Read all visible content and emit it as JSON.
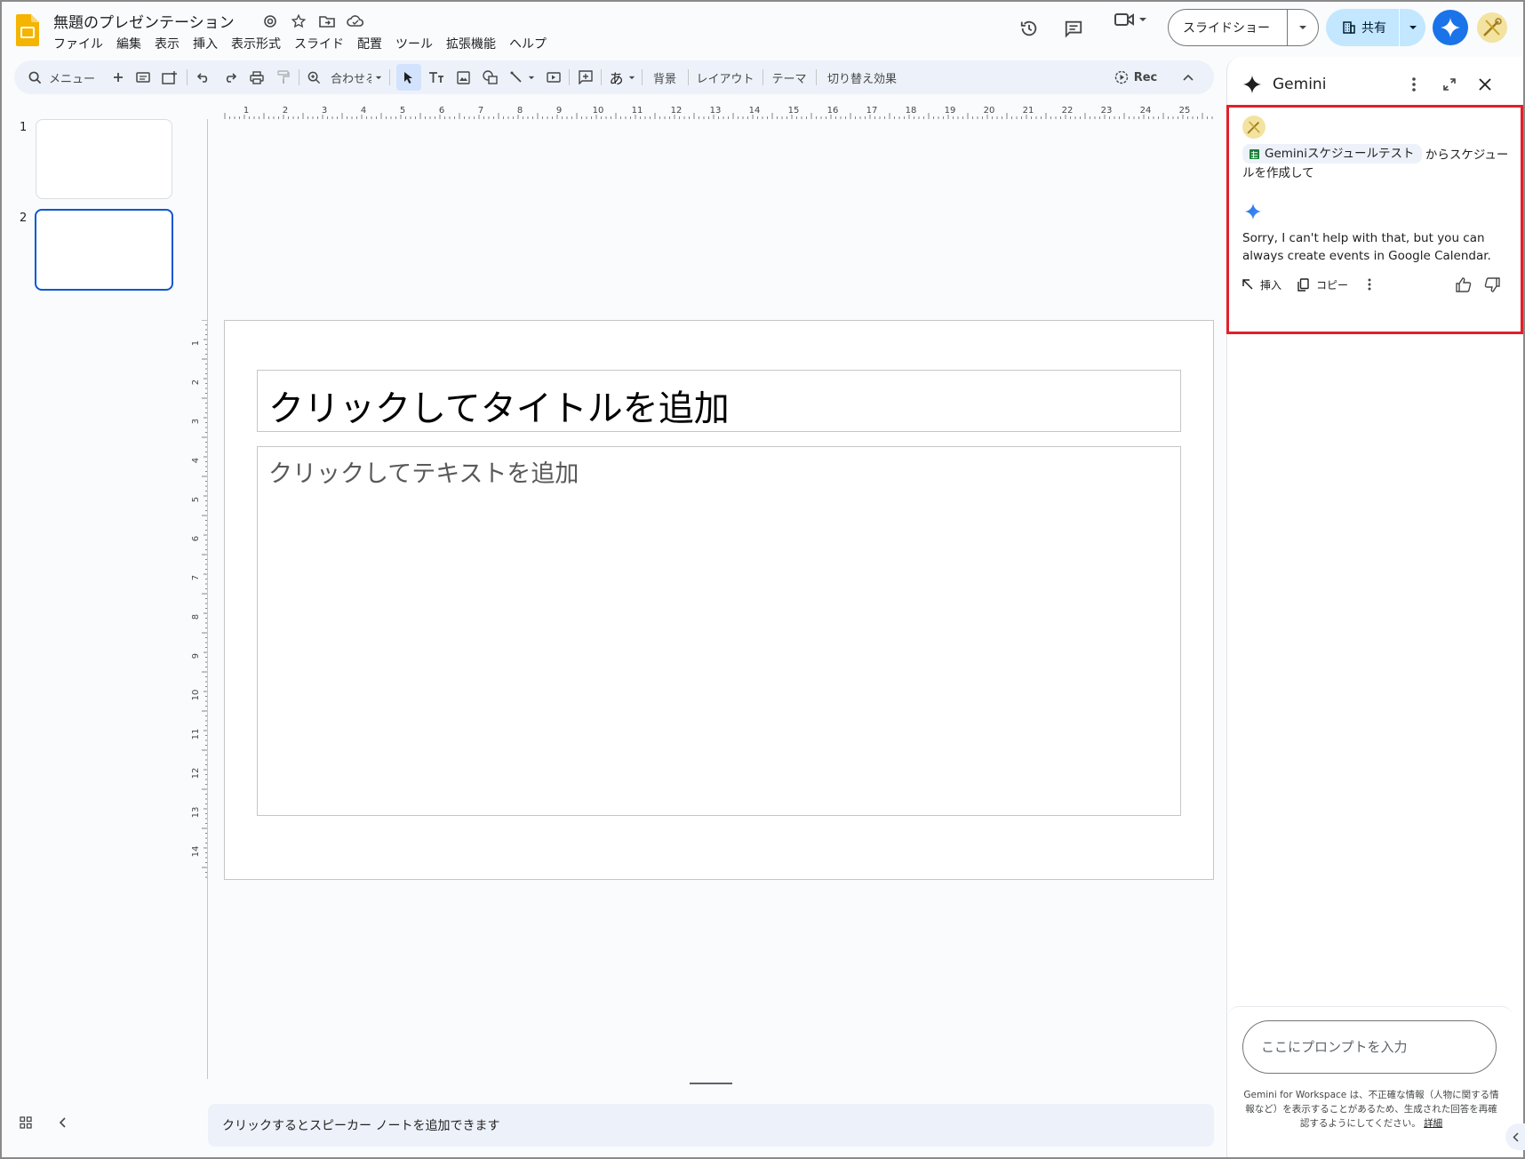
{
  "app": {
    "doc_title": "無題のプレゼンテーション",
    "menu": [
      "ファイル",
      "編集",
      "表示",
      "挿入",
      "表示形式",
      "スライド",
      "配置",
      "ツール",
      "拡張機能",
      "ヘルプ"
    ]
  },
  "header": {
    "slideshow_label": "スライドショー",
    "share_label": "共有"
  },
  "toolbar": {
    "menu_search": "メニュー",
    "zoom_label": "合わせる",
    "font_char": "あ",
    "background": "背景",
    "layout": "レイアウト",
    "theme": "テーマ",
    "transition": "切り替え効果",
    "rec": "Rec"
  },
  "filmstrip": {
    "slides": [
      {
        "number": "1",
        "selected": false
      },
      {
        "number": "2",
        "selected": true
      }
    ]
  },
  "ruler": {
    "horizontal": [
      "1",
      "2",
      "3",
      "4",
      "5",
      "6",
      "7",
      "8",
      "9",
      "10",
      "11",
      "12",
      "13",
      "14",
      "15",
      "16",
      "17",
      "18",
      "19",
      "20",
      "21",
      "22",
      "23",
      "24",
      "25"
    ],
    "vertical": [
      "1",
      "2",
      "3",
      "4",
      "5",
      "6",
      "7",
      "8",
      "9",
      "10",
      "11",
      "12",
      "13",
      "14"
    ]
  },
  "slide": {
    "title_placeholder": "クリックしてタイトルを追加",
    "body_placeholder": "クリックしてテキストを追加"
  },
  "notes": {
    "placeholder": "クリックするとスピーカー ノートを追加できます"
  },
  "gemini": {
    "header": "Gemini",
    "user_message": {
      "file_chip": "Geminiスケジュールテスト",
      "text": "からスケジュールを作成して"
    },
    "reply": "Sorry, I can't help with that, but you can always create events in Google Calendar.",
    "actions": {
      "insert": "挿入",
      "copy": "コピー"
    },
    "prompt_placeholder": "ここにプロンプトを入力",
    "disclaimer": "Gemini for Workspace は、不正確な情報（人物に関する情報など）を表示することがあるため、生成された回答を再確認するようにしてください。",
    "disclaimer_link": "詳細"
  },
  "colors": {
    "accent": "#0b57d0",
    "share_bg": "#c2e7ff",
    "highlight": "#e0202a",
    "toolbar_bg": "#edf2fa"
  }
}
